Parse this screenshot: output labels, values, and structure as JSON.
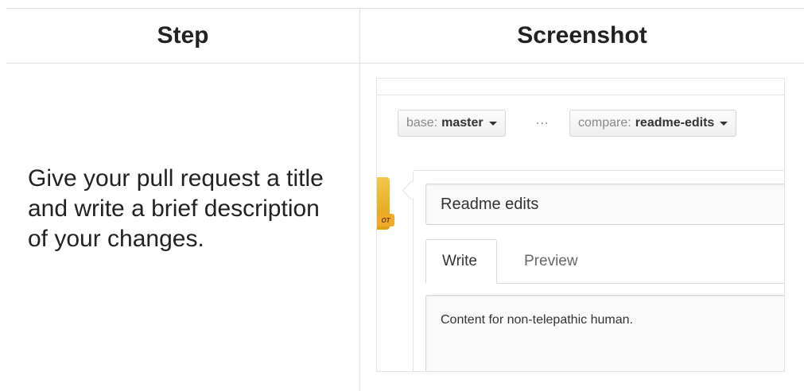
{
  "table": {
    "headers": [
      "Step",
      "Screenshot"
    ],
    "step_text": "Give your pull request a title and write a brief description of your changes."
  },
  "screenshot": {
    "base_label": "base:",
    "base_branch": "master",
    "ellipsis": "...",
    "compare_label": "compare:",
    "compare_branch": "readme-edits",
    "title_value": "Readme edits",
    "tabs": [
      "Write",
      "Preview"
    ],
    "body_value": "Content for non-telepathic human.",
    "avatar_tag": "OT"
  }
}
